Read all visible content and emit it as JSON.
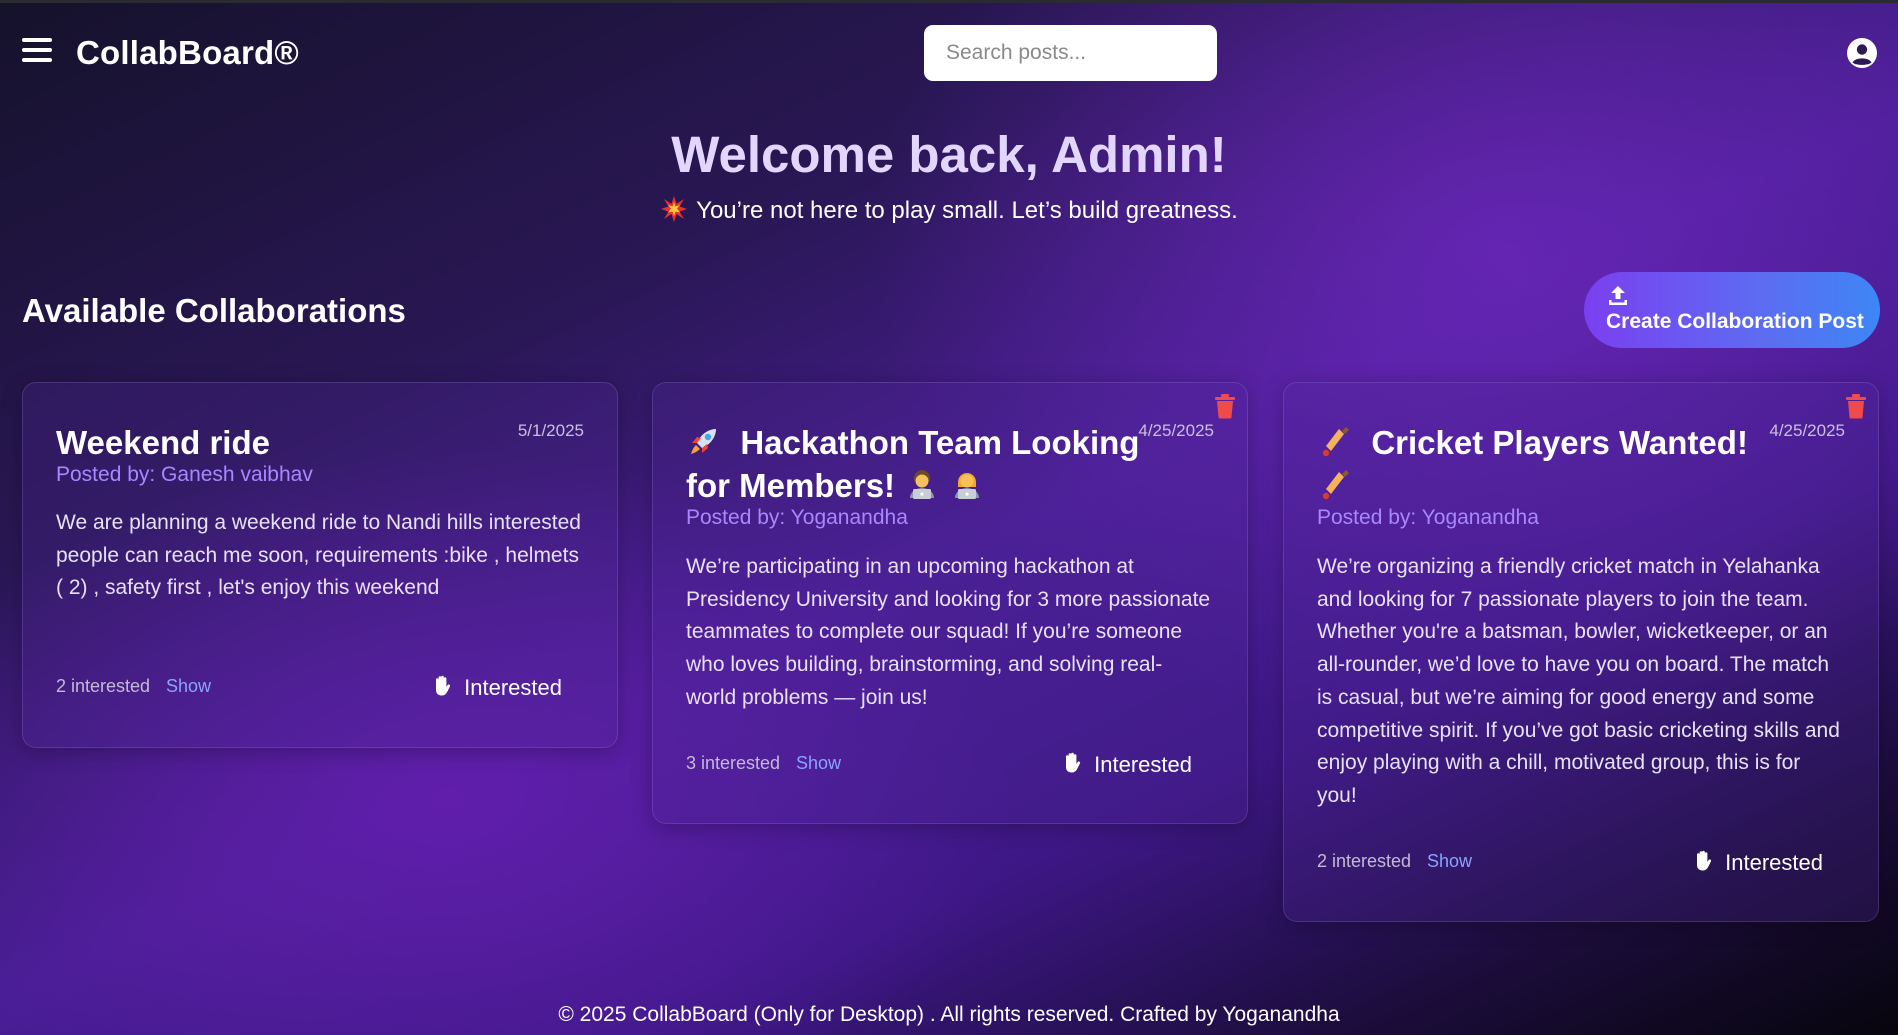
{
  "navbar": {
    "brand": "CollabBoard®",
    "search_placeholder": "Search posts..."
  },
  "hero": {
    "title": "Welcome back, Admin!",
    "subtitle": "You’re not here to play small. Let’s build greatness."
  },
  "section": {
    "title": "Available Collaborations",
    "create_button": "Create Collaboration Post"
  },
  "posts": [
    {
      "title": "Weekend ride",
      "date": "5/1/2025",
      "author": "Posted by: Ganesh vaibhav",
      "description": "We are planning a weekend ride to Nandi hills interested people can reach me soon, requirements :bike , helmets ( 2) , safety first , let's enjoy this weekend",
      "interested_count": "2 interested",
      "show_label": "Show",
      "interested_label": "Interested"
    },
    {
      "title": "Hackathon Team Looking for Members!",
      "date": "4/25/2025",
      "author": "Posted by: Yoganandha",
      "description": "We’re participating in an upcoming hackathon at Presidency University and looking for 3 more passionate teammates to complete our squad! If you’re someone who loves building, brainstorming, and solving real-world problems — join us!",
      "interested_count": "3 interested",
      "show_label": "Show",
      "interested_label": "Interested"
    },
    {
      "title": "Cricket Players Wanted!",
      "date": "4/25/2025",
      "author": "Posted by: Yoganandha",
      "description": "We’re organizing a friendly cricket match in Yelahanka and looking for 7 passionate players to join the team. Whether you're a batsman, bowler, wicketkeeper, or an all-rounder, we’d love to have you on board. The match is casual, but we’re aiming for good energy and some competitive spirit. If you’ve got basic cricketing skills and enjoy playing with a chill, motivated group, this is for you!",
      "interested_count": "2 interested",
      "show_label": "Show",
      "interested_label": "Interested"
    }
  ],
  "footer": {
    "text": "© 2025 CollabBoard (Only for Desktop) . All rights reserved. Crafted by Yoganandha"
  },
  "icons": {
    "menu": "hamburger-menu-icon",
    "user": "user-circle-icon",
    "spark": "collision-spark-icon",
    "upload": "upload-icon",
    "delete": "trash-icon",
    "hand": "raised-hand-icon",
    "rocket": "rocket-icon",
    "technologist": "technologist-icon",
    "cricket": "cricket-bat-icon"
  },
  "colors": {
    "accent_purple": "#a987ff",
    "hero_title": "#e2d6ff",
    "delete_red": "#f04a4a",
    "show_link": "#8aa4ff",
    "create_gradient_start": "#7b3ff0",
    "create_gradient_end": "#3d86f5"
  }
}
